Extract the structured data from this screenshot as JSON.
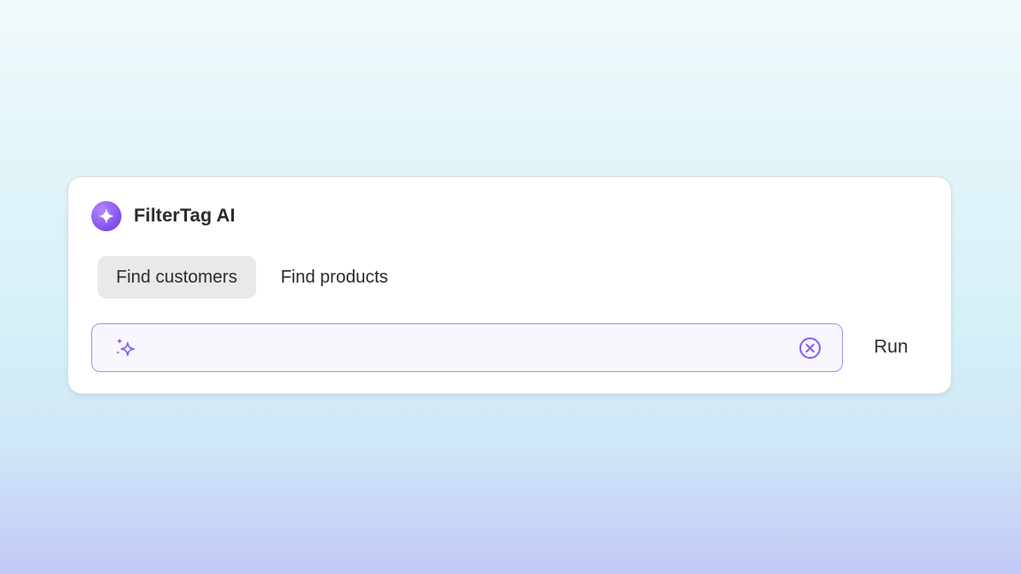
{
  "app": {
    "title": "FilterTag AI",
    "logo_icon": "sparkle-icon"
  },
  "tabs": [
    {
      "label": "Find customers",
      "active": true
    },
    {
      "label": "Find products",
      "active": false
    }
  ],
  "search": {
    "value": "",
    "placeholder": "",
    "leading_icon": "sparkles-icon",
    "clear_icon": "close-circle-icon"
  },
  "actions": {
    "run_label": "Run"
  },
  "colors": {
    "accent": "#8b5cf6",
    "input_border": "#a98cf5",
    "active_tab_bg": "#e9e9ea",
    "text": "#2b2b2f"
  }
}
